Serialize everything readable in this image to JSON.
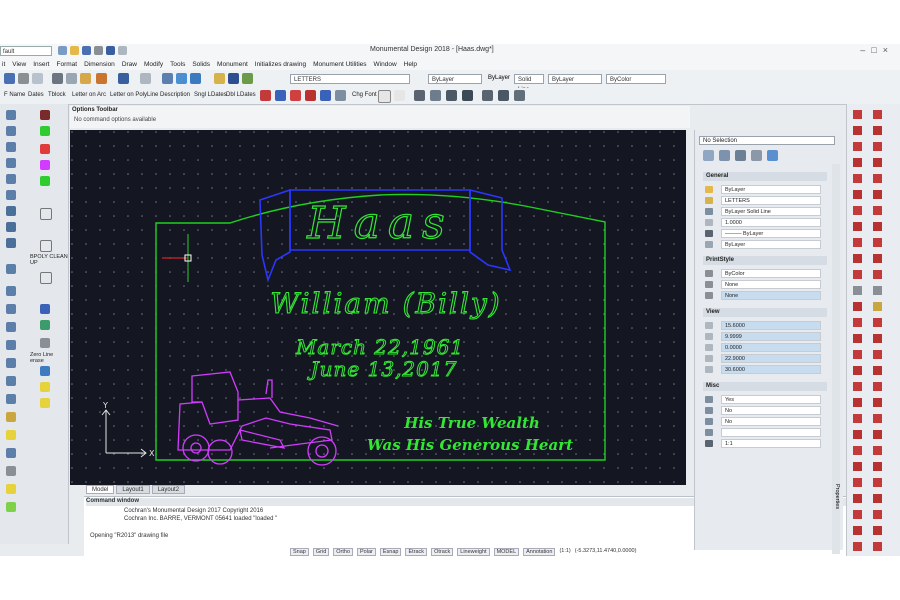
{
  "app": {
    "window_title": "Monumental Design 2018 - [Haas.dwg*]",
    "workspace_combo": "fault"
  },
  "menu": [
    "it",
    "View",
    "Insert",
    "Format",
    "Dimension",
    "Draw",
    "Modify",
    "Tools",
    "Solids",
    "Monument",
    "Initializes drawing",
    "Monument Utilities",
    "Window",
    "Help"
  ],
  "toolbar1": {
    "textstyle_combo": "LETTERS",
    "color_combo": "ByLayer",
    "layer_label": "ByLayer",
    "linetype_combo": "Solid Line",
    "lineweight_combo": "ByLayer",
    "plotstyle_combo": "ByColor"
  },
  "toolbar2": [
    "F Name",
    "Dates",
    "Tblock",
    "Letter on Arc",
    "Letter on PolyLine",
    "Description",
    "Sngl LDates",
    "Dbl LDates",
    "Chg Font"
  ],
  "left_palette": {
    "labels": [
      "BPOLY CLEAN UP",
      "Zero Line erase"
    ]
  },
  "options_toolbar": {
    "title": "Options Toolbar",
    "status": "No command options available"
  },
  "drawing": {
    "family_name": "Haas",
    "first_name": "William (Billy)",
    "birth_date": "March 22,1961",
    "death_date": "June 13,2017",
    "epitaph_line1": "His True Wealth",
    "epitaph_line2": "Was His Generous Heart",
    "ucs_x": "X",
    "ucs_y": "Y",
    "colors": {
      "background": "#141722",
      "outline": "#1fd11f",
      "banner": "#2b36ff",
      "text": "#33e633",
      "grader": "#d23cff",
      "cursor": "#ff2a2a"
    }
  },
  "layout_tabs": [
    "Model",
    "Layout1",
    "Layout2"
  ],
  "command_window": {
    "title": "Command window",
    "lines": [
      "Cochran's Monumental Design 2017 Copyright 2016",
      "Cochran Inc. BARRE, VERMONT 05641        loaded \"loaded \""
    ],
    "opening_line": "Opening \"R2013\" drawing file"
  },
  "status_bar": [
    "Snap",
    "Grid",
    "Ortho",
    "Polar",
    "Esnap",
    "Etrack",
    "Otrack",
    "Lineweight",
    "MODEL",
    "Annotation",
    "(1:1)",
    "(-5.3273,11.4740,0.0000)"
  ],
  "properties": {
    "selection": "No Selection",
    "general_title": "General",
    "general": [
      "ByLayer",
      "LETTERS",
      "ByLayer    Solid Line",
      "1.0000",
      "——— ByLayer",
      "ByLayer"
    ],
    "printstyle_title": "PrintStyle",
    "printstyle": [
      "ByColor",
      "None",
      "None"
    ],
    "view_title": "View",
    "view": [
      "15.6000",
      "9.9999",
      "0.0000",
      "22.9000",
      "30.6000"
    ],
    "misc_title": "Misc",
    "misc": [
      "Yes",
      "No",
      "No",
      "",
      "1:1"
    ],
    "tab_label": "Properties"
  }
}
